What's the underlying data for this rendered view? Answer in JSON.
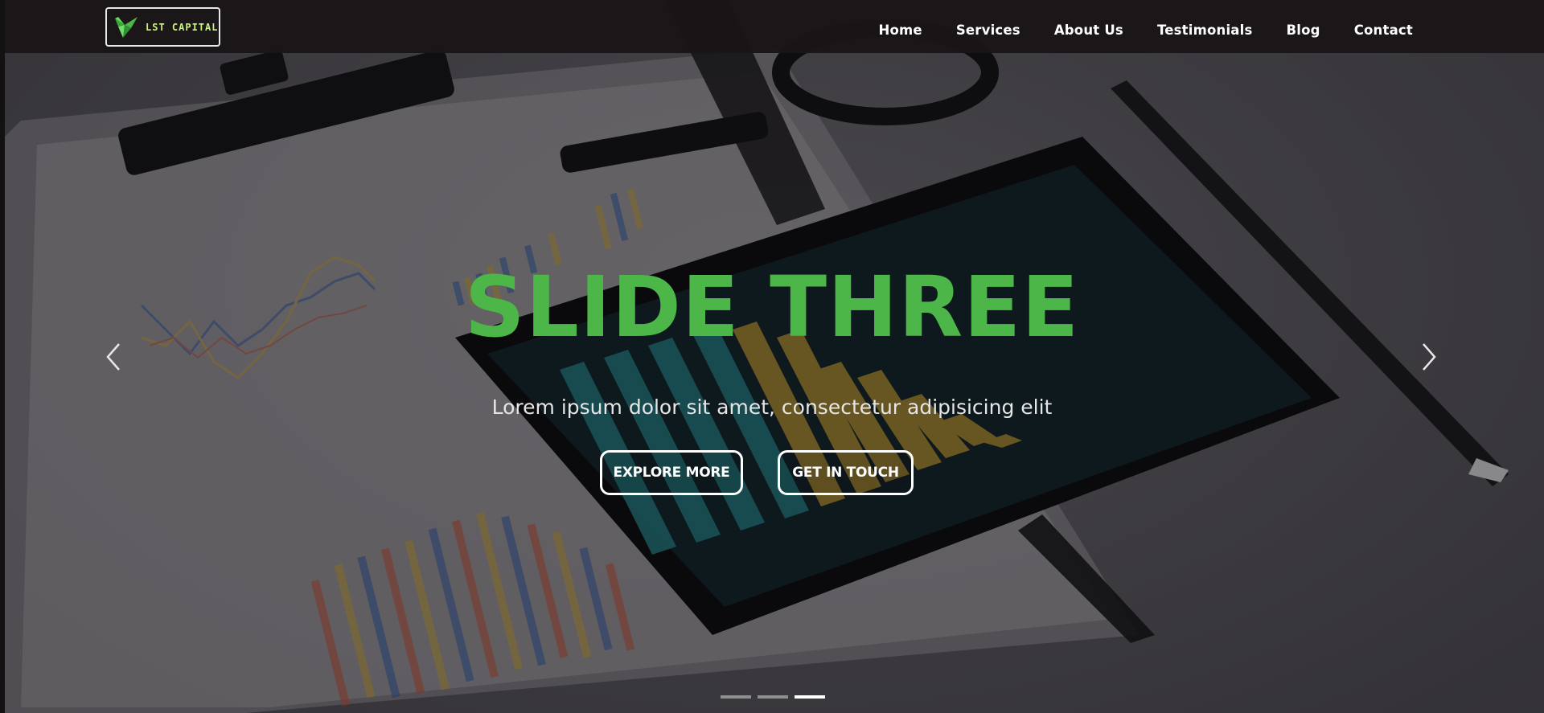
{
  "brand": {
    "name": "LST CAPITAL",
    "accent_color": "#c9f27a",
    "logo_icon": "origami-bird-icon"
  },
  "nav": {
    "items": [
      {
        "label": "Home"
      },
      {
        "label": "Services"
      },
      {
        "label": "About Us"
      },
      {
        "label": "Testimonials"
      },
      {
        "label": "Blog"
      },
      {
        "label": "Contact"
      }
    ]
  },
  "slide": {
    "title": "SLIDE THREE",
    "title_color": "#4cb649",
    "subtitle": "Lorem ipsum dolor sit amet, consectetur adipisicing elit",
    "buttons": {
      "explore": "EXPLORE MORE",
      "touch": "GET IN TOUCH"
    },
    "prev_icon": "chevron-left-icon",
    "next_icon": "chevron-right-icon",
    "active_index": 3,
    "slide_count": 3
  }
}
